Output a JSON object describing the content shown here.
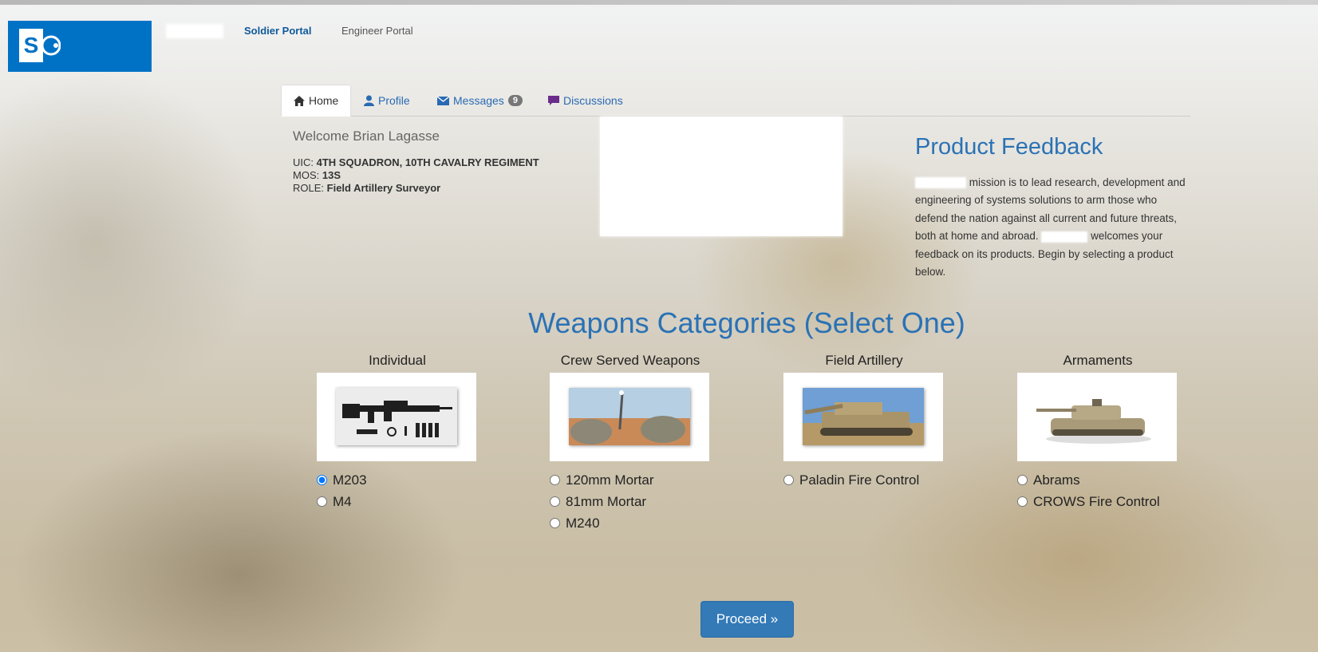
{
  "header": {
    "portals": [
      {
        "label": "Soldier Portal",
        "active": true
      },
      {
        "label": "Engineer Portal",
        "active": false
      }
    ],
    "logo_letter": "S"
  },
  "tabs": [
    {
      "label": "Home",
      "icon": "home-icon"
    },
    {
      "label": "Profile",
      "icon": "user-icon"
    },
    {
      "label": "Messages",
      "icon": "envelope-icon",
      "badge": "9"
    },
    {
      "label": "Discussions",
      "icon": "comment-icon"
    }
  ],
  "user": {
    "welcome": "Welcome Brian Lagasse",
    "uic_label": "UIC:",
    "uic": "4TH SQUADRON, 10TH CAVALRY REGIMENT",
    "mos_label": "MOS:",
    "mos": "13S",
    "role_label": "ROLE:",
    "role": "Field Artillery Surveyor"
  },
  "feedback": {
    "title": "Product Feedback",
    "text_1": "mission is to lead research, development and engineering of systems solutions to arm those who defend the nation against all current and future threats, both at home and abroad.",
    "text_2": "welcomes your feedback on its products. Begin by selecting a product below."
  },
  "weapons": {
    "title": "Weapons Categories (Select One)",
    "categories": [
      {
        "name": "Individual",
        "image": "rifle-image",
        "options": [
          {
            "label": "M203",
            "checked": true
          },
          {
            "label": "M4",
            "checked": false
          }
        ]
      },
      {
        "name": "Crew Served Weapons",
        "image": "mortar-image",
        "options": [
          {
            "label": "120mm Mortar",
            "checked": false
          },
          {
            "label": "81mm Mortar",
            "checked": false
          },
          {
            "label": "M240",
            "checked": false
          }
        ]
      },
      {
        "name": "Field Artillery",
        "image": "howitzer-image",
        "options": [
          {
            "label": "Paladin Fire Control",
            "checked": false
          }
        ]
      },
      {
        "name": "Armaments",
        "image": "tank-image",
        "options": [
          {
            "label": "Abrams",
            "checked": false
          },
          {
            "label": "CROWS Fire Control",
            "checked": false
          }
        ]
      }
    ]
  },
  "proceed_label": "Proceed »",
  "colors": {
    "brand": "#0072c6",
    "accent": "#2a72b5",
    "button": "#337ab7"
  }
}
